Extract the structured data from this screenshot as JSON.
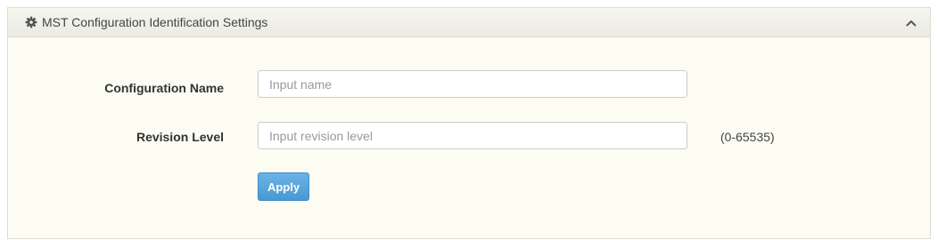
{
  "panel": {
    "title": "MST Configuration Identification Settings",
    "header_icon": "gear-icon",
    "collapse_icon": "chevron-up-icon"
  },
  "form": {
    "configuration_name": {
      "label": "Configuration Name",
      "value": "",
      "placeholder": "Input name"
    },
    "revision_level": {
      "label": "Revision Level",
      "value": "",
      "placeholder": "Input revision level",
      "range_hint": "(0-65535)"
    },
    "apply_label": "Apply"
  },
  "colors": {
    "panel_background": "#fcfcf2",
    "header_background": "#efefe8",
    "apply_button": "#5aa5dc"
  }
}
